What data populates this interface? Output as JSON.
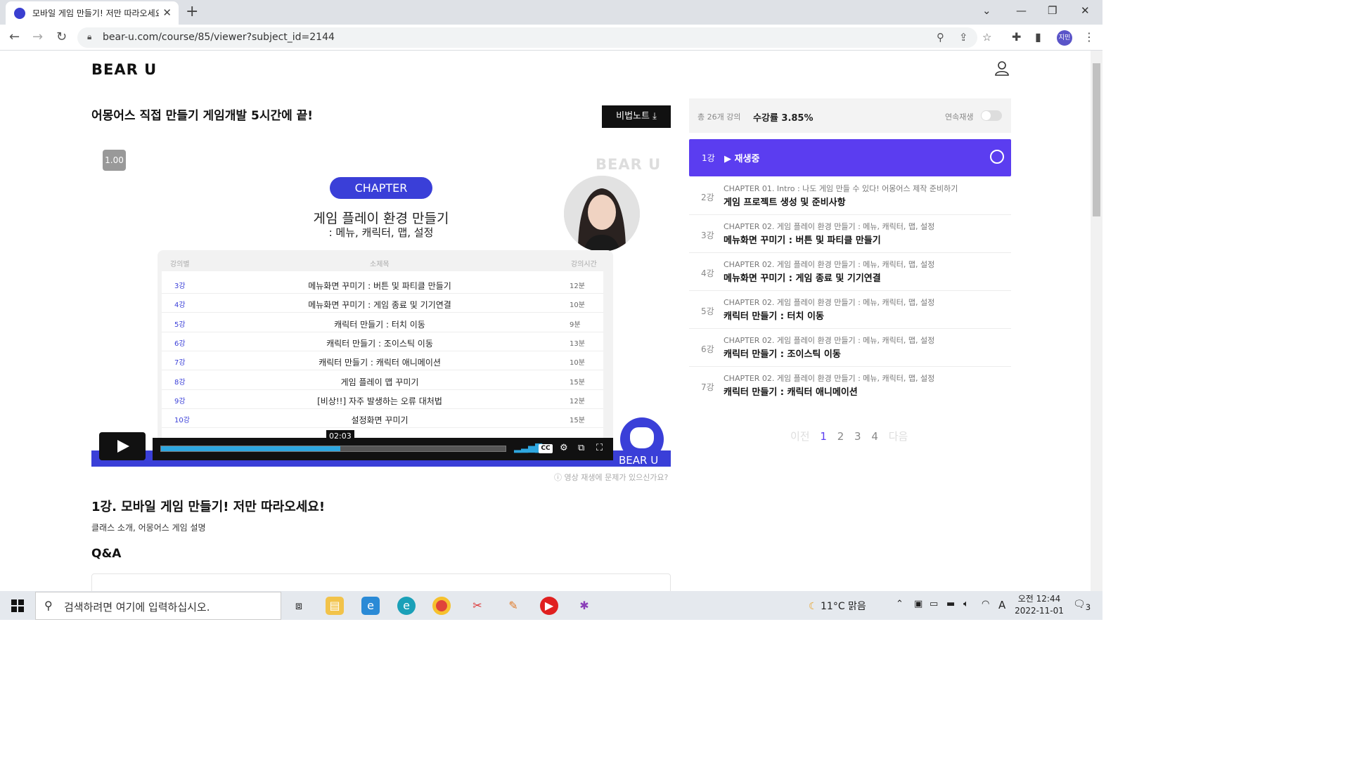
{
  "browser": {
    "tab_title": "모바일 게임 만들기! 저만 따라오세요!",
    "url": "bear-u.com/course/85/viewer?subject_id=2144",
    "profile_label": "지민"
  },
  "header": {
    "logo": "BEAR U"
  },
  "course": {
    "title": "어몽어스 직접 만들기 게임개발 5시간에 끝!",
    "note_button": "비법노트"
  },
  "video": {
    "speed": "1.00",
    "watermark": "BEAR U",
    "chapter_pill": "CHAPTER",
    "heading": "게임 플레이 환경 만들기",
    "subheading": ": 메뉴, 캐릭터, 맵, 설정",
    "table_headers": {
      "num": "강의별",
      "title": "소제목",
      "time": "강의시간"
    },
    "rows": [
      {
        "num": "3강",
        "title": "메뉴화면 꾸미기 : 버튼 및 파티클 만들기",
        "time": "12분"
      },
      {
        "num": "4강",
        "title": "메뉴화면 꾸미기 : 게임 종료 및 기기연결",
        "time": "10분"
      },
      {
        "num": "5강",
        "title": "캐릭터 만들기 : 터치 이동",
        "time": "9분"
      },
      {
        "num": "6강",
        "title": "캐릭터 만들기 : 조이스틱 이동",
        "time": "13분"
      },
      {
        "num": "7강",
        "title": "캐릭터 만들기 : 캐릭터 애니메이션",
        "time": "10분"
      },
      {
        "num": "8강",
        "title": "게임 플레이 맵 꾸미기",
        "time": "15분"
      },
      {
        "num": "9강",
        "title": "[비상!!] 자주 발생하는 오류 대처법",
        "time": "12분"
      },
      {
        "num": "10강",
        "title": "설정화면 꾸미기",
        "time": "15분"
      }
    ],
    "time_tooltip": "02:03",
    "progress": 0.52,
    "cc_label": "CC",
    "badge_text": "BEAR U"
  },
  "report_link": "영상 재생에 문제가 있으신가요?",
  "lesson": {
    "title": "1강. 모바일 게임 만들기! 저만 따라오세요!",
    "description": "클래스 소개, 어몽어스 게임 설명"
  },
  "qa_heading": "Q&A",
  "sidebar": {
    "total": "총 26개 강의",
    "rate": "수강률 3.85%",
    "autoplay_label": "연속재생",
    "now_playing": {
      "num": "1강",
      "label": "재생중"
    },
    "lessons": [
      {
        "num": "2강",
        "chapter": "CHAPTER 01. Intro : 나도 게임 만들 수 있다! 어몽어스 제작 준비하기",
        "title": "게임 프로젝트 생성 및 준비사항"
      },
      {
        "num": "3강",
        "chapter": "CHAPTER 02. 게임 플레이 환경 만들기 : 메뉴, 캐릭터, 맵, 설정",
        "title": "메뉴화면 꾸미기 : 버튼 및 파티클 만들기"
      },
      {
        "num": "4강",
        "chapter": "CHAPTER 02. 게임 플레이 환경 만들기 : 메뉴, 캐릭터, 맵, 설정",
        "title": "메뉴화면 꾸미기 : 게임 종료 및 기기연결"
      },
      {
        "num": "5강",
        "chapter": "CHAPTER 02. 게임 플레이 환경 만들기 : 메뉴, 캐릭터, 맵, 설정",
        "title": "캐릭터 만들기 : 터치 이동"
      },
      {
        "num": "6강",
        "chapter": "CHAPTER 02. 게임 플레이 환경 만들기 : 메뉴, 캐릭터, 맵, 설정",
        "title": "캐릭터 만들기 : 조이스틱 이동"
      },
      {
        "num": "7강",
        "chapter": "CHAPTER 02. 게임 플레이 환경 만들기 : 메뉴, 캐릭터, 맵, 설정",
        "title": "캐릭터 만들기 : 캐릭터 애니메이션"
      }
    ],
    "pager": {
      "prev": "이전",
      "pages": [
        "1",
        "2",
        "3",
        "4"
      ],
      "next": "다음"
    }
  },
  "taskbar": {
    "search_placeholder": "검색하려면 여기에 입력하십시오.",
    "weather": "11°C 맑음",
    "ime": "A",
    "time": "오전 12:44",
    "date": "2022-11-01",
    "notification_count": "3"
  },
  "colors": {
    "accent": "#3a3fd8",
    "now_playing": "#5b3df0",
    "progress": "#2ea7e0"
  }
}
